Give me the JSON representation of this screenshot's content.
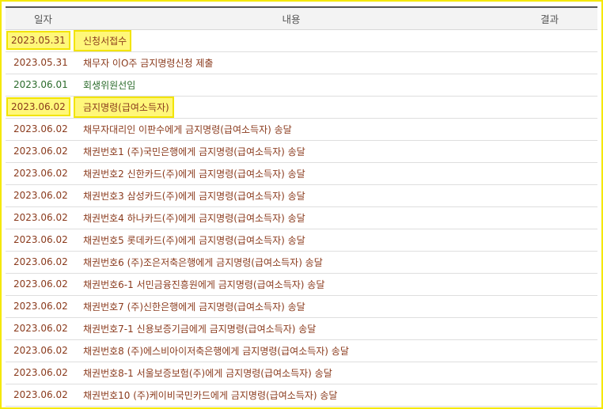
{
  "table": {
    "headers": {
      "date": "일자",
      "content": "내용",
      "result": "결과"
    },
    "rows": [
      {
        "date": "2023.05.31",
        "content": "신청서접수",
        "result": "",
        "highlight": true,
        "color": "#8a3a1c"
      },
      {
        "date": "2023.05.31",
        "content": "채무자 이O주 금지명령신청 제출",
        "result": "",
        "highlight": false,
        "color": "#8a3a1c"
      },
      {
        "date": "2023.06.01",
        "content": "회생위원선임",
        "result": "",
        "highlight": false,
        "color": "#2b6b2b"
      },
      {
        "date": "2023.06.02",
        "content": "금지명령(급여소득자)",
        "result": "",
        "highlight": true,
        "color": "#8a3a1c"
      },
      {
        "date": "2023.06.02",
        "content": "채무자대리인 이판수에게 금지명령(급여소득자) 송달",
        "result": "",
        "highlight": false,
        "color": "#8a3a1c"
      },
      {
        "date": "2023.06.02",
        "content": "채권번호1 (주)국민은행에게 금지명령(급여소득자) 송달",
        "result": "",
        "highlight": false,
        "color": "#8a3a1c"
      },
      {
        "date": "2023.06.02",
        "content": "채권번호2 신한카드(주)에게 금지명령(급여소득자) 송달",
        "result": "",
        "highlight": false,
        "color": "#8a3a1c"
      },
      {
        "date": "2023.06.02",
        "content": "채권번호3 삼성카드(주)에게 금지명령(급여소득자) 송달",
        "result": "",
        "highlight": false,
        "color": "#8a3a1c"
      },
      {
        "date": "2023.06.02",
        "content": "채권번호4 하나카드(주)에게 금지명령(급여소득자) 송달",
        "result": "",
        "highlight": false,
        "color": "#8a3a1c"
      },
      {
        "date": "2023.06.02",
        "content": "채권번호5 롯데카드(주)에게 금지명령(급여소득자) 송달",
        "result": "",
        "highlight": false,
        "color": "#8a3a1c"
      },
      {
        "date": "2023.06.02",
        "content": "채권번호6 (주)조은저축은행에게 금지명령(급여소득자) 송달",
        "result": "",
        "highlight": false,
        "color": "#8a3a1c"
      },
      {
        "date": "2023.06.02",
        "content": "채권번호6-1 서민금융진흥원에게 금지명령(급여소득자) 송달",
        "result": "",
        "highlight": false,
        "color": "#8a3a1c"
      },
      {
        "date": "2023.06.02",
        "content": "채권번호7 (주)신한은행에게 금지명령(급여소득자) 송달",
        "result": "",
        "highlight": false,
        "color": "#8a3a1c"
      },
      {
        "date": "2023.06.02",
        "content": "채권번호7-1 신용보증기금에게 금지명령(급여소득자) 송달",
        "result": "",
        "highlight": false,
        "color": "#8a3a1c"
      },
      {
        "date": "2023.06.02",
        "content": "채권번호8 (주)에스비아이저축은행에게 금지명령(급여소득자) 송달",
        "result": "",
        "highlight": false,
        "color": "#8a3a1c"
      },
      {
        "date": "2023.06.02",
        "content": "채권번호8-1 서울보증보험(주)에게 금지명령(급여소득자) 송달",
        "result": "",
        "highlight": false,
        "color": "#8a3a1c"
      },
      {
        "date": "2023.06.02",
        "content": "채권번호10 (주)케이비국민카드에게 금지명령(급여소득자) 송달",
        "result": "",
        "highlight": false,
        "color": "#8a3a1c"
      }
    ]
  },
  "colors": {
    "frame_border": "#f5e800",
    "highlight_fill": "#fff77a",
    "text_brown": "#8a3a1c",
    "text_green": "#2b6b2b",
    "header_bg": "#f3f3f3"
  }
}
